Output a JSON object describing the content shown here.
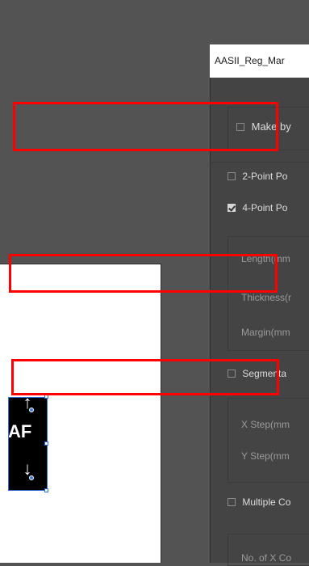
{
  "panel": {
    "tab_title": "AASII_Reg_Mar",
    "make_by_label": "Make by",
    "two_point_label": "2-Point Po",
    "four_point_label": "4-Point Po",
    "length_label": "Length(mm",
    "thickness_label": "Thickness(r",
    "margin_label": "Margin(mm",
    "segmented_label": "Segmenta",
    "x_step_label": "X Step(mm",
    "y_step_label": "Y Step(mm",
    "multiple_label": "Multiple Co",
    "no_of_x_label": "No. of X Co"
  },
  "canvas": {
    "mark_label": "AF",
    "mark_up_arrow": "↑",
    "mark_down_arrow": "↓"
  },
  "state": {
    "make_by_checked": false,
    "two_point_checked": false,
    "four_point_checked": true,
    "segmented_checked": false,
    "multiple_checked": false
  },
  "colors": {
    "highlight": "#ff0000",
    "selection": "#2d6fd8"
  }
}
